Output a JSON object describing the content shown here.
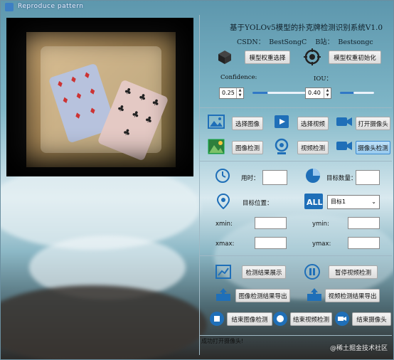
{
  "window": {
    "title": "Reproduce pattern"
  },
  "header": {
    "title": "基于YOLOv5模型的扑克牌检测识别系统V1.0",
    "subtitle": "CSDN：  BestSongC    B站：  Bestsongc"
  },
  "model": {
    "select_label": "模型权重选择",
    "init_label": "模型权重初始化",
    "confidence_label": "Confidence:",
    "iou_label": "IOU：",
    "confidence_value": "0.25",
    "iou_value": "0.40",
    "confidence_level": 0.25,
    "iou_level": 0.4
  },
  "input": {
    "select_image": "选择图像",
    "select_video": "选择视频",
    "open_camera": "打开摄像头",
    "image_detect": "图像检测",
    "video_detect": "视频检测",
    "camera_detect": "摄像头检测"
  },
  "results": {
    "time_label": "用时：",
    "count_label": "目标数量：",
    "position_label": "目标位置：",
    "target_select": "目标1",
    "xmin_label": "xmin:",
    "ymin_label": "ymin:",
    "xmax_label": "xmax:",
    "ymax_label": "ymax:"
  },
  "actions": {
    "show_results": "检测结果展示",
    "pause_video": "暂停视频检测",
    "export_image": "图像检测结果导出",
    "export_video": "视频检测结果导出",
    "end_image": "结束图像检测",
    "end_video": "结束视频检测",
    "end_camera": "结束摄像头"
  },
  "status": {
    "text": "成功打开摄像头!"
  },
  "watermark": "@稀土掘金技术社区",
  "colors": {
    "accent": "#3178c6",
    "active_button": "#99cbef"
  }
}
